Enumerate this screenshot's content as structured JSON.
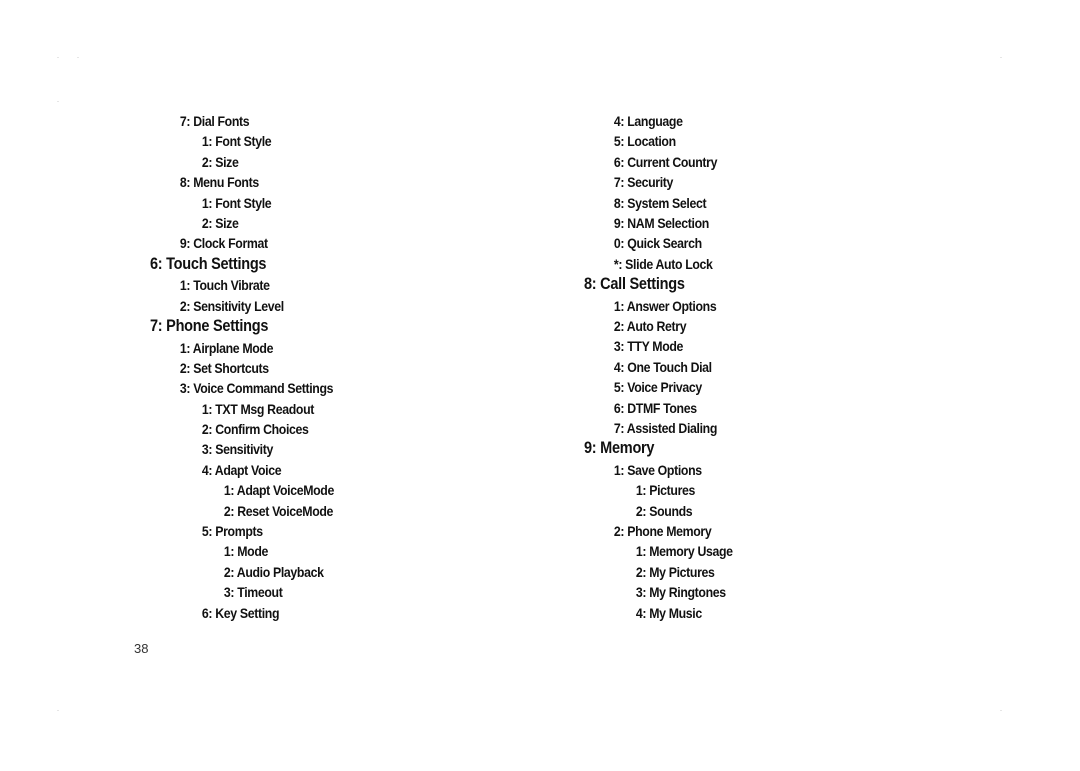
{
  "page_number": "38",
  "left_column": [
    {
      "level": 1,
      "text": "7: Dial Fonts"
    },
    {
      "level": 2,
      "text": "1: Font Style"
    },
    {
      "level": 2,
      "text": "2: Size"
    },
    {
      "level": 1,
      "text": "8: Menu Fonts"
    },
    {
      "level": 2,
      "text": "1: Font Style"
    },
    {
      "level": 2,
      "text": "2: Size"
    },
    {
      "level": 1,
      "text": "9: Clock Format"
    },
    {
      "level": 0,
      "text": "6: Touch Settings"
    },
    {
      "level": 1,
      "text": "1: Touch Vibrate"
    },
    {
      "level": 1,
      "text": "2: Sensitivity Level"
    },
    {
      "level": 0,
      "text": "7: Phone Settings"
    },
    {
      "level": 1,
      "text": "1: Airplane Mode"
    },
    {
      "level": 1,
      "text": "2: Set Shortcuts"
    },
    {
      "level": 1,
      "text": "3: Voice Command Settings"
    },
    {
      "level": 2,
      "text": "1: TXT Msg Readout"
    },
    {
      "level": 2,
      "text": "2: Confirm Choices"
    },
    {
      "level": 2,
      "text": "3: Sensitivity"
    },
    {
      "level": 2,
      "text": "4: Adapt Voice"
    },
    {
      "level": 3,
      "text": "1: Adapt VoiceMode"
    },
    {
      "level": 3,
      "text": "2: Reset VoiceMode"
    },
    {
      "level": 2,
      "text": "5: Prompts"
    },
    {
      "level": 3,
      "text": "1: Mode"
    },
    {
      "level": 3,
      "text": "2: Audio Playback"
    },
    {
      "level": 3,
      "text": "3: Timeout"
    },
    {
      "level": 2,
      "text": "6: Key Setting"
    }
  ],
  "right_column": [
    {
      "level": 1,
      "text": "4: Language"
    },
    {
      "level": 1,
      "text": "5: Location"
    },
    {
      "level": 1,
      "text": "6: Current Country"
    },
    {
      "level": 1,
      "text": "7: Security"
    },
    {
      "level": 1,
      "text": "8: System Select"
    },
    {
      "level": 1,
      "text": "9: NAM Selection"
    },
    {
      "level": 1,
      "text": "0: Quick Search"
    },
    {
      "level": 1,
      "text": "*: Slide Auto Lock"
    },
    {
      "level": 0,
      "text": "8: Call Settings"
    },
    {
      "level": 1,
      "text": "1: Answer Options"
    },
    {
      "level": 1,
      "text": "2: Auto Retry"
    },
    {
      "level": 1,
      "text": "3: TTY Mode"
    },
    {
      "level": 1,
      "text": "4: One Touch Dial"
    },
    {
      "level": 1,
      "text": "5: Voice Privacy"
    },
    {
      "level": 1,
      "text": "6: DTMF Tones"
    },
    {
      "level": 1,
      "text": "7: Assisted Dialing"
    },
    {
      "level": 0,
      "text": "9: Memory"
    },
    {
      "level": 1,
      "text": "1: Save Options"
    },
    {
      "level": 2,
      "text": "1: Pictures"
    },
    {
      "level": 2,
      "text": "2: Sounds"
    },
    {
      "level": 1,
      "text": "2: Phone Memory"
    },
    {
      "level": 2,
      "text": "1: Memory Usage"
    },
    {
      "level": 2,
      "text": "2: My Pictures"
    },
    {
      "level": 2,
      "text": "3: My Ringtones"
    },
    {
      "level": 2,
      "text": "4: My Music"
    }
  ]
}
